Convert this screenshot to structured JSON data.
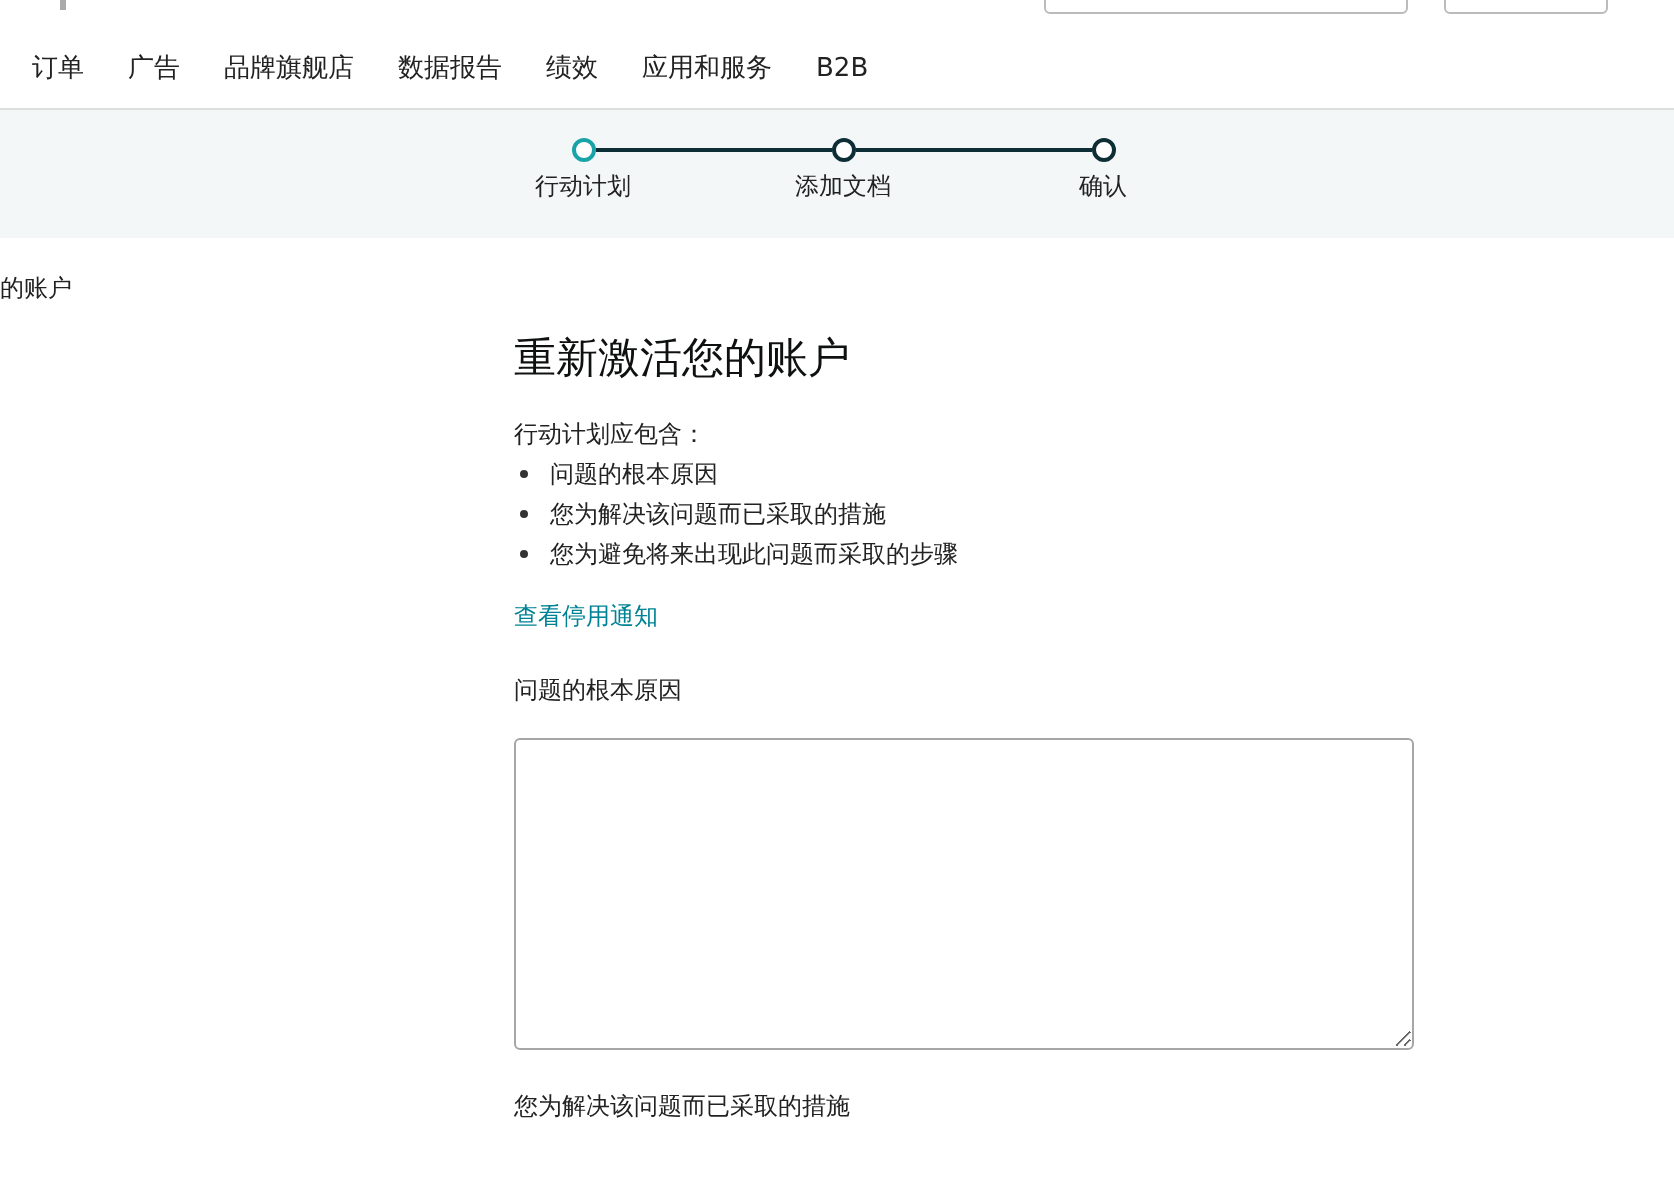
{
  "nav": {
    "items": [
      {
        "label": "订单"
      },
      {
        "label": "广告"
      },
      {
        "label": "品牌旗舰店"
      },
      {
        "label": "数据报告"
      },
      {
        "label": "绩效"
      },
      {
        "label": "应用和服务"
      },
      {
        "label": "B2B"
      }
    ]
  },
  "steps": [
    {
      "label": "行动计划",
      "selected": true
    },
    {
      "label": "添加文档",
      "selected": false
    },
    {
      "label": "确认",
      "selected": false
    }
  ],
  "breadcrumb": "的账户",
  "form": {
    "title": "重新激活您的账户",
    "intro": "行动计划应包含：",
    "bullets": [
      "问题的根本原因",
      "您为解决该问题而已采取的措施",
      "您为避免将来出现此问题而采取的步骤"
    ],
    "link": "查看停用通知",
    "fields": [
      {
        "label": "问题的根本原因",
        "kind": "textarea"
      },
      {
        "label": "您为解决该问题而已采取的措施",
        "kind": "label-only"
      }
    ]
  }
}
